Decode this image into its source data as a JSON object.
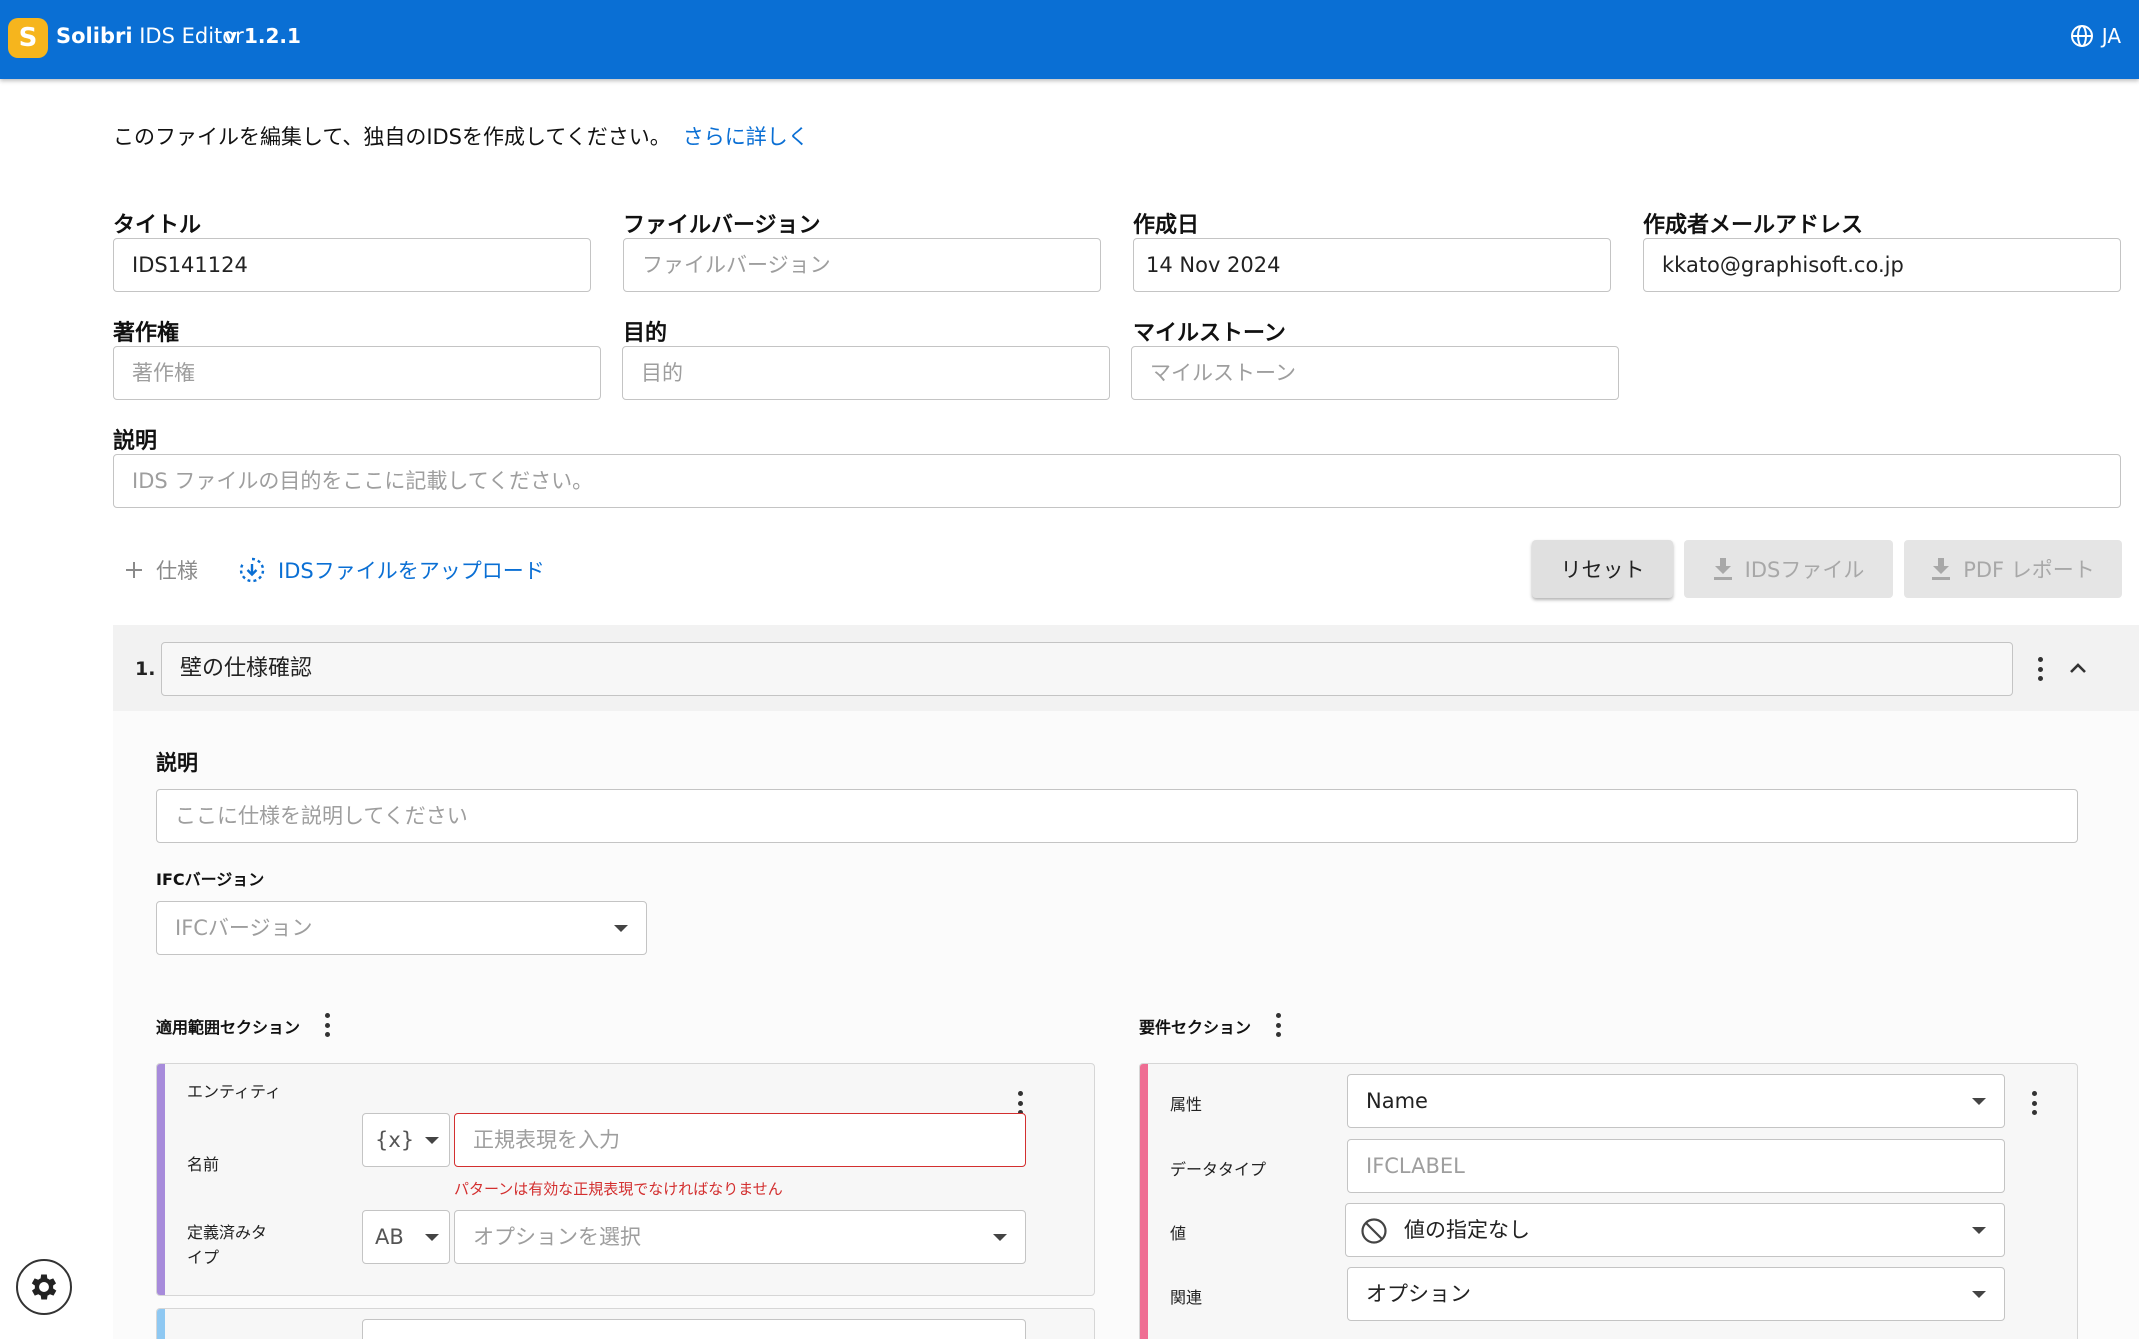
{
  "header": {
    "logo_letter": "S",
    "app_brand": "Solibri",
    "app_product": "IDS Editor",
    "version": "v 1.2.1",
    "language": "JA",
    "color": "#0a6fd4"
  },
  "intro": {
    "text": "このファイルを編集して、独自のIDSを作成してください。",
    "link": "さらに詳しく"
  },
  "fields": {
    "title": {
      "label": "タイトル",
      "value": "IDS141124"
    },
    "file_version": {
      "label": "ファイルバージョン",
      "placeholder": "ファイルバージョン"
    },
    "date": {
      "label": "作成日",
      "value": "14 Nov 2024"
    },
    "author_email": {
      "label": "作成者メールアドレス",
      "value": "kkato@graphisoft.co.jp"
    },
    "copyright": {
      "label": "著作権",
      "placeholder": "著作権"
    },
    "purpose": {
      "label": "目的",
      "placeholder": "目的"
    },
    "milestone": {
      "label": "マイルストーン",
      "placeholder": "マイルストーン"
    },
    "description": {
      "label": "説明",
      "placeholder": "IDS ファイルの目的をここに記載してください。"
    }
  },
  "toolbar": {
    "add_spec": "仕様",
    "upload": "IDSファイルをアップロード",
    "reset": "リセット",
    "ids_file": "IDSファイル",
    "pdf_report": "PDF レポート"
  },
  "spec": {
    "number": "1.",
    "name": "壁の仕様確認",
    "description_label": "説明",
    "description_placeholder": "ここに仕様を説明してください",
    "ifc_label": "IFCバージョン",
    "ifc_placeholder": "IFCバージョン",
    "applicability_label": "適用範囲セクション",
    "requirements_label": "要件セクション",
    "entity_card": {
      "title": "エンティティ",
      "name_label": "名前",
      "name_type": "{x}",
      "name_placeholder": "正規表現を入力",
      "name_error": "パターンは有効な正規表現でなければなりません",
      "predefined_label_1": "定義済みタ",
      "predefined_label_2": "イプ",
      "predefined_type": "AB",
      "predefined_placeholder": "オプションを選択",
      "stripe_color": "#a78bdb"
    },
    "requirement_card": {
      "attribute_label": "属性",
      "attribute_value": "Name",
      "datatype_label": "データタイプ",
      "datatype_placeholder": "IFCLABEL",
      "value_label": "値",
      "value_value": "値の指定なし",
      "relation_label": "関連",
      "relation_value": "オプション",
      "stripe_color": "#ef6d93"
    }
  }
}
